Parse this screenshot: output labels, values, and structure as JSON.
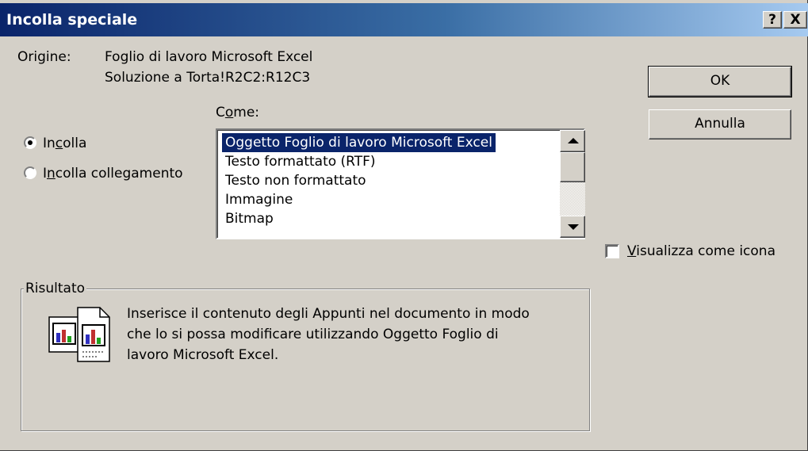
{
  "dialog": {
    "title": "Incolla speciale",
    "help_button": "?",
    "close_button": "X"
  },
  "source": {
    "label": "Origine:",
    "line1": "Foglio di lavoro Microsoft Excel",
    "line2": "Soluzione a Torta!R2C2:R12C3"
  },
  "as": {
    "label_pre": "C",
    "label_key": "o",
    "label_post": "me:"
  },
  "paste_mode": {
    "paste": {
      "pre": "In",
      "key": "c",
      "post": "olla",
      "selected": true
    },
    "paste_link": {
      "pre": "I",
      "key": "n",
      "post": "colla collegamento",
      "selected": false
    }
  },
  "formats": {
    "items": [
      "Oggetto Foglio di lavoro Microsoft Excel",
      "Testo formattato (RTF)",
      "Testo non formattato",
      "Immagine",
      "Bitmap"
    ],
    "selected_index": 0
  },
  "buttons": {
    "ok": "OK",
    "cancel": "Annulla"
  },
  "display_as_icon": {
    "pre": "",
    "key": "V",
    "post": "isualizza come icona",
    "checked": false
  },
  "result": {
    "label": "Risultato",
    "line1": "Inserisce il contenuto degli Appunti nel documento in modo",
    "line2": "che lo si possa modificare utilizzando Oggetto Foglio di",
    "line3": "lavoro Microsoft Excel.",
    "icon": "paste-object-icon"
  },
  "colors": {
    "face": "#d4d0c8",
    "title_start": "#0a246a",
    "title_end": "#a6caf0",
    "selection": "#0a246a"
  }
}
